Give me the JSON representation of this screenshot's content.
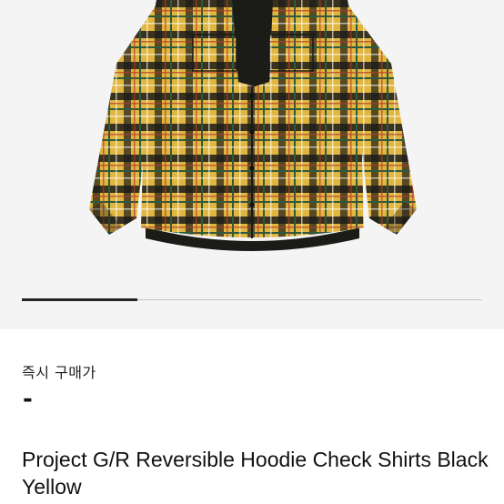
{
  "product": {
    "image_alt": "Yellow and black plaid reversible hoodie check shirt",
    "price_label": "즉시 구매가",
    "price_value": "-",
    "title": "Project G/R Reversible Hoodie Check Shirts Black Yellow"
  },
  "gallery": {
    "progress_fraction": 0.25
  },
  "colors": {
    "background": "#ffffff",
    "image_background": "#f4f4f4",
    "plaid_yellow": "#e0b640",
    "plaid_black": "#1b1b18",
    "plaid_green": "#2f5a3c",
    "progress_active": "#222222",
    "progress_track": "#c9c9c9"
  }
}
